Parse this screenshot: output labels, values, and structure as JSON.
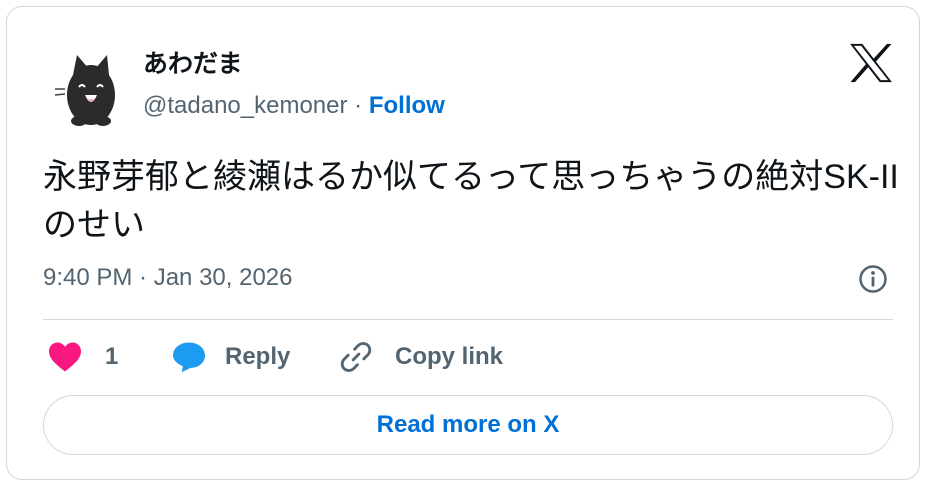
{
  "author": {
    "display_name": "あわだま",
    "handle": "@tadano_kemoner",
    "separator": " · ",
    "follow_label": "Follow",
    "avatar_icon": "black-cat-avatar-icon"
  },
  "tweet": {
    "text": "永野芽郁と綾瀬はるか似てるって思っちゃうの絶対SK-IIのせい",
    "timestamp": "9:40 PM · Jan 30, 2026"
  },
  "actions": {
    "like_count": "1",
    "reply_label": "Reply",
    "copy_link_label": "Copy link"
  },
  "read_more_label": "Read more on X",
  "colors": {
    "link_blue": "#006fd6",
    "like_pink": "#f91880",
    "reply_blue": "#1d9bf0",
    "text_primary": "#0f1419",
    "text_secondary": "#536471",
    "border": "#cfd9de"
  }
}
